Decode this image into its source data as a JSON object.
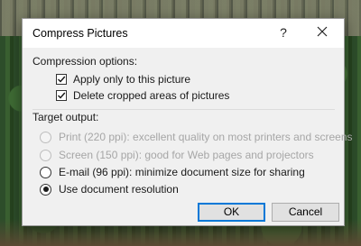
{
  "dialog": {
    "title": "Compress Pictures",
    "help_label": "?",
    "compression": {
      "heading": "Compression options:",
      "apply_only_label": "Apply only to this picture",
      "apply_only_checked": true,
      "delete_cropped_label": "Delete cropped areas of pictures",
      "delete_cropped_checked": true
    },
    "target": {
      "heading": "Target output:",
      "options": [
        {
          "label": "Print (220 ppi): excellent quality on most printers and screens",
          "enabled": false,
          "selected": false
        },
        {
          "label": "Screen (150 ppi): good for Web pages and projectors",
          "enabled": false,
          "selected": false
        },
        {
          "label": "E-mail (96 ppi): minimize document size for sharing",
          "enabled": true,
          "selected": false
        },
        {
          "label": "Use document resolution",
          "enabled": true,
          "selected": true
        }
      ]
    },
    "buttons": {
      "ok": "OK",
      "cancel": "Cancel"
    }
  },
  "colors": {
    "accent": "#0078d7",
    "dialog_bg": "#f0f0f0",
    "disabled_text": "#a6a6a6"
  }
}
